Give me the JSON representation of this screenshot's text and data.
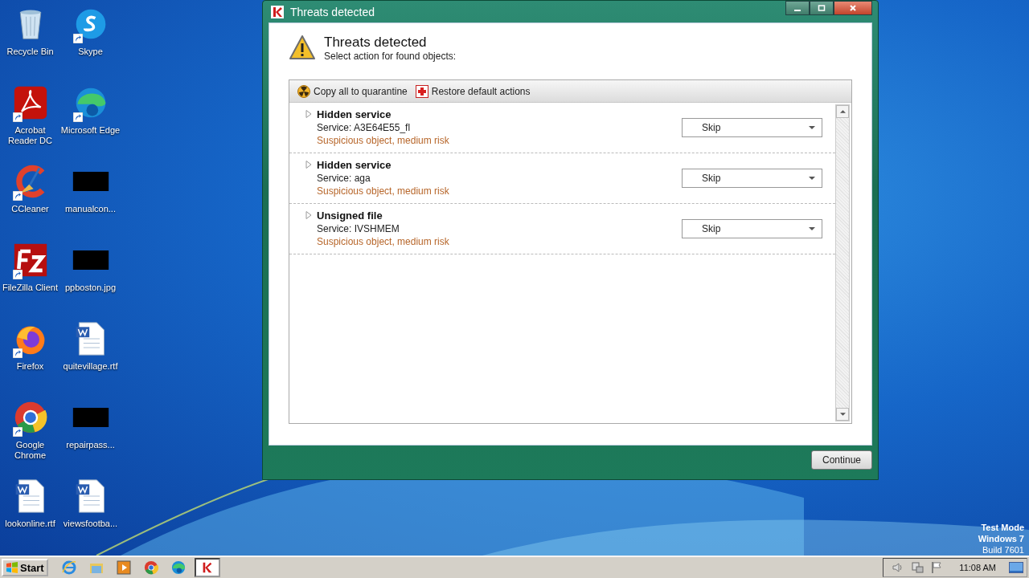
{
  "desktop": {
    "icons": [
      {
        "label": "Recycle Bin",
        "kind": "recycle-bin",
        "shortcut": false
      },
      {
        "label": "Acrobat Reader DC",
        "kind": "acrobat",
        "shortcut": true
      },
      {
        "label": "CCleaner",
        "kind": "ccleaner",
        "shortcut": true
      },
      {
        "label": "FileZilla Client",
        "kind": "filezilla",
        "shortcut": true
      },
      {
        "label": "Firefox",
        "kind": "firefox",
        "shortcut": true
      },
      {
        "label": "Google Chrome",
        "kind": "chrome",
        "shortcut": true
      },
      {
        "label": "lookonline.rtf",
        "kind": "word",
        "shortcut": false
      },
      {
        "label": "Skype",
        "kind": "skype",
        "shortcut": true
      },
      {
        "label": "Microsoft Edge",
        "kind": "edge",
        "shortcut": true
      },
      {
        "label": "manualcon...",
        "kind": "redacted",
        "shortcut": false
      },
      {
        "label": "ppboston.jpg",
        "kind": "redacted",
        "shortcut": false
      },
      {
        "label": "quitevillage.rtf",
        "kind": "word",
        "shortcut": false
      },
      {
        "label": "repairpass...",
        "kind": "redacted",
        "shortcut": false
      },
      {
        "label": "viewsfootba...",
        "kind": "word",
        "shortcut": false
      }
    ],
    "system_info": {
      "mode": "Test Mode",
      "os": "Windows 7",
      "build": "Build 7601"
    }
  },
  "window": {
    "title": "Threats detected",
    "heading": "Threats detected",
    "subtitle": "Select action for found objects:",
    "toolbar": [
      {
        "label": "Copy all to quarantine",
        "kind": "quarantine"
      },
      {
        "label": "Restore default actions",
        "kind": "restore"
      }
    ],
    "threats": [
      {
        "name": "Hidden service",
        "service": "Service: A3E64E55_fl",
        "risk": "Suspicious object, medium risk",
        "action": "Skip",
        "expanded": false
      },
      {
        "name": "Hidden service",
        "service": "Service: aga",
        "risk": "Suspicious object, medium risk",
        "action": "Skip",
        "expanded": false
      },
      {
        "name": "Unsigned file",
        "service": "Service: IVSHMEM",
        "risk": "Suspicious object, medium risk",
        "action": "Skip",
        "expanded": false
      }
    ],
    "continue_button": "Continue"
  },
  "taskbar": {
    "start": "Start",
    "apps": [
      {
        "kind": "ie",
        "selected": false
      },
      {
        "kind": "explorer",
        "selected": false
      },
      {
        "kind": "media",
        "selected": false
      },
      {
        "kind": "chrome",
        "selected": false
      },
      {
        "kind": "edge",
        "selected": false
      },
      {
        "kind": "kaspersky",
        "selected": true
      }
    ],
    "clock": "11:08 AM"
  }
}
